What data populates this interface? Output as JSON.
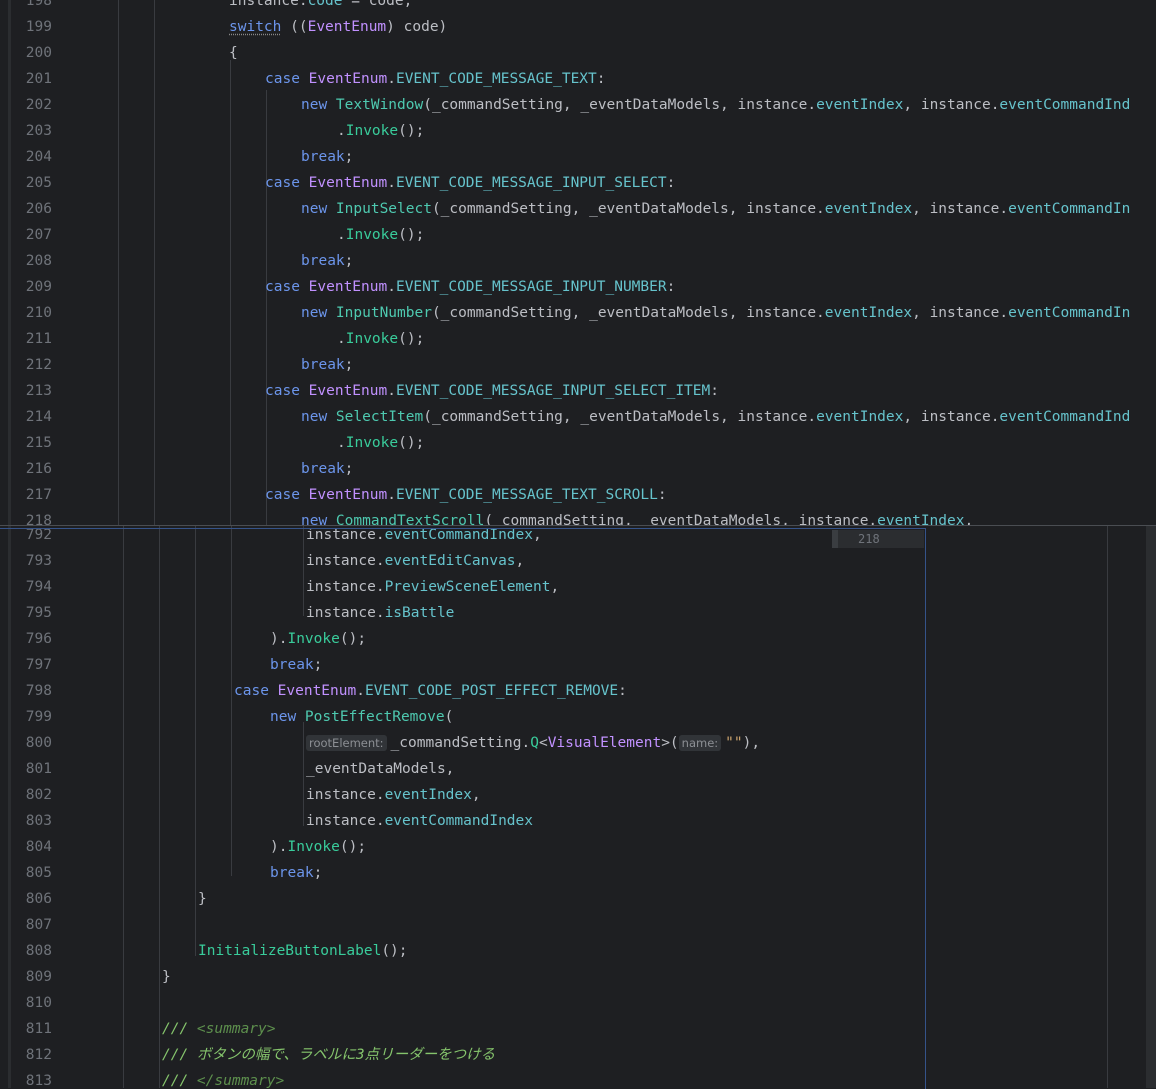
{
  "sticky_badge": "218",
  "top_lines": [
    {
      "n": "198",
      "indent": 7,
      "segs": [
        [
          "",
          "instance."
        ],
        [
          "pr",
          "code"
        ],
        [
          "",
          " = code;"
        ]
      ]
    },
    {
      "n": "199",
      "indent": 7,
      "segs": [
        [
          "kw squiggle",
          "switch"
        ],
        [
          "",
          " (("
        ],
        [
          "cl",
          "EventEnum"
        ],
        [
          "",
          ") code)"
        ]
      ]
    },
    {
      "n": "200",
      "indent": 7,
      "segs": [
        [
          "",
          "{"
        ]
      ]
    },
    {
      "n": "201",
      "indent": 8,
      "segs": [
        [
          "kw",
          "case "
        ],
        [
          "cl",
          "EventEnum"
        ],
        [
          "",
          "."
        ],
        [
          "pr",
          "EVENT_CODE_MESSAGE_TEXT"
        ],
        [
          "",
          ":"
        ]
      ]
    },
    {
      "n": "202",
      "indent": 9,
      "segs": [
        [
          "kw",
          "new "
        ],
        [
          "ty",
          "TextWindow"
        ],
        [
          "",
          "(_commandSetting, _eventDataModels, instance."
        ],
        [
          "pr",
          "eventIndex"
        ],
        [
          "",
          ", instance."
        ],
        [
          "pr",
          "eventCommandInd"
        ]
      ]
    },
    {
      "n": "203",
      "indent": 10,
      "segs": [
        [
          "",
          "."
        ],
        [
          "fn",
          "Invoke"
        ],
        [
          "",
          "();"
        ]
      ]
    },
    {
      "n": "204",
      "indent": 9,
      "segs": [
        [
          "kw",
          "break"
        ],
        [
          "",
          ";"
        ]
      ]
    },
    {
      "n": "205",
      "indent": 8,
      "segs": [
        [
          "kw",
          "case "
        ],
        [
          "cl",
          "EventEnum"
        ],
        [
          "",
          "."
        ],
        [
          "pr",
          "EVENT_CODE_MESSAGE_INPUT_SELECT"
        ],
        [
          "",
          ":"
        ]
      ]
    },
    {
      "n": "206",
      "indent": 9,
      "segs": [
        [
          "kw",
          "new "
        ],
        [
          "ty",
          "InputSelect"
        ],
        [
          "",
          "(_commandSetting, _eventDataModels, instance."
        ],
        [
          "pr",
          "eventIndex"
        ],
        [
          "",
          ", instance."
        ],
        [
          "pr",
          "eventCommandIn"
        ]
      ]
    },
    {
      "n": "207",
      "indent": 10,
      "segs": [
        [
          "",
          "."
        ],
        [
          "fn",
          "Invoke"
        ],
        [
          "",
          "();"
        ]
      ]
    },
    {
      "n": "208",
      "indent": 9,
      "segs": [
        [
          "kw",
          "break"
        ],
        [
          "",
          ";"
        ]
      ]
    },
    {
      "n": "209",
      "indent": 8,
      "segs": [
        [
          "kw",
          "case "
        ],
        [
          "cl",
          "EventEnum"
        ],
        [
          "",
          "."
        ],
        [
          "pr",
          "EVENT_CODE_MESSAGE_INPUT_NUMBER"
        ],
        [
          "",
          ":"
        ]
      ]
    },
    {
      "n": "210",
      "indent": 9,
      "segs": [
        [
          "kw",
          "new "
        ],
        [
          "ty",
          "InputNumber"
        ],
        [
          "",
          "(_commandSetting, _eventDataModels, instance."
        ],
        [
          "pr",
          "eventIndex"
        ],
        [
          "",
          ", instance."
        ],
        [
          "pr",
          "eventCommandIn"
        ]
      ]
    },
    {
      "n": "211",
      "indent": 10,
      "segs": [
        [
          "",
          "."
        ],
        [
          "fn",
          "Invoke"
        ],
        [
          "",
          "();"
        ]
      ]
    },
    {
      "n": "212",
      "indent": 9,
      "segs": [
        [
          "kw",
          "break"
        ],
        [
          "",
          ";"
        ]
      ]
    },
    {
      "n": "213",
      "indent": 8,
      "segs": [
        [
          "kw",
          "case "
        ],
        [
          "cl",
          "EventEnum"
        ],
        [
          "",
          "."
        ],
        [
          "pr",
          "EVENT_CODE_MESSAGE_INPUT_SELECT_ITEM"
        ],
        [
          "",
          ":"
        ]
      ]
    },
    {
      "n": "214",
      "indent": 9,
      "segs": [
        [
          "kw",
          "new "
        ],
        [
          "ty",
          "SelectItem"
        ],
        [
          "",
          "(_commandSetting, _eventDataModels, instance."
        ],
        [
          "pr",
          "eventIndex"
        ],
        [
          "",
          ", instance."
        ],
        [
          "pr",
          "eventCommandInd"
        ]
      ]
    },
    {
      "n": "215",
      "indent": 10,
      "segs": [
        [
          "",
          "."
        ],
        [
          "fn",
          "Invoke"
        ],
        [
          "",
          "();"
        ]
      ]
    },
    {
      "n": "216",
      "indent": 9,
      "segs": [
        [
          "kw",
          "break"
        ],
        [
          "",
          ";"
        ]
      ]
    },
    {
      "n": "217",
      "indent": 8,
      "segs": [
        [
          "kw",
          "case "
        ],
        [
          "cl",
          "EventEnum"
        ],
        [
          "",
          "."
        ],
        [
          "pr",
          "EVENT_CODE_MESSAGE_TEXT_SCROLL"
        ],
        [
          "",
          ":"
        ]
      ]
    },
    {
      "n": "218",
      "indent": 9,
      "segs": [
        [
          "kw",
          "new "
        ],
        [
          "ty",
          "CommandTextScroll"
        ],
        [
          "",
          "(_commandSetting, _eventDataModels, instance."
        ],
        [
          "pr",
          "eventIndex"
        ],
        [
          "",
          ","
        ]
      ]
    }
  ],
  "bottom_lines": [
    {
      "n": "792",
      "indent": 9,
      "segs": [
        [
          "",
          "instance."
        ],
        [
          "pr",
          "eventCommandIndex"
        ],
        [
          "",
          ","
        ]
      ]
    },
    {
      "n": "793",
      "indent": 9,
      "segs": [
        [
          "",
          "instance."
        ],
        [
          "pr",
          "eventEditCanvas"
        ],
        [
          "",
          ","
        ]
      ]
    },
    {
      "n": "794",
      "indent": 9,
      "segs": [
        [
          "",
          "instance."
        ],
        [
          "pr",
          "PreviewSceneElement"
        ],
        [
          "",
          ","
        ]
      ]
    },
    {
      "n": "795",
      "indent": 9,
      "segs": [
        [
          "",
          "instance."
        ],
        [
          "pr",
          "isBattle"
        ]
      ]
    },
    {
      "n": "796",
      "indent": 8,
      "segs": [
        [
          "",
          ")."
        ],
        [
          "fn",
          "Invoke"
        ],
        [
          "",
          "();"
        ]
      ]
    },
    {
      "n": "797",
      "indent": 8,
      "segs": [
        [
          "kw",
          "break"
        ],
        [
          "",
          ";"
        ]
      ]
    },
    {
      "n": "798",
      "indent": 7,
      "segs": [
        [
          "kw",
          "case "
        ],
        [
          "cl",
          "EventEnum"
        ],
        [
          "",
          "."
        ],
        [
          "pr",
          "EVENT_CODE_POST_EFFECT_REMOVE"
        ],
        [
          "",
          ":"
        ]
      ]
    },
    {
      "n": "799",
      "indent": 8,
      "segs": [
        [
          "kw",
          "new "
        ],
        [
          "ty",
          "PostEffectRemove"
        ],
        [
          "",
          "("
        ]
      ]
    },
    {
      "n": "800",
      "indent": 9,
      "segs": [
        [
          "hint",
          "rootElement:"
        ],
        [
          "",
          "_commandSetting."
        ],
        [
          "fn",
          "Q"
        ],
        [
          "",
          "<"
        ],
        [
          "cl",
          "VisualElement"
        ],
        [
          "",
          ">("
        ],
        [
          "hint",
          "name:"
        ],
        [
          "st",
          "\"\""
        ],
        [
          "",
          "),"
        ]
      ]
    },
    {
      "n": "801",
      "indent": 9,
      "segs": [
        [
          "",
          "_eventDataModels,"
        ]
      ]
    },
    {
      "n": "802",
      "indent": 9,
      "segs": [
        [
          "",
          "instance."
        ],
        [
          "pr",
          "eventIndex"
        ],
        [
          "",
          ","
        ]
      ]
    },
    {
      "n": "803",
      "indent": 9,
      "segs": [
        [
          "",
          "instance."
        ],
        [
          "pr",
          "eventCommandIndex"
        ]
      ]
    },
    {
      "n": "804",
      "indent": 8,
      "segs": [
        [
          "",
          ")."
        ],
        [
          "fn",
          "Invoke"
        ],
        [
          "",
          "();"
        ]
      ]
    },
    {
      "n": "805",
      "indent": 8,
      "segs": [
        [
          "kw",
          "break"
        ],
        [
          "",
          ";"
        ]
      ]
    },
    {
      "n": "806",
      "indent": 6,
      "segs": [
        [
          "",
          "}"
        ]
      ]
    },
    {
      "n": "807",
      "indent": 0,
      "segs": []
    },
    {
      "n": "808",
      "indent": 6,
      "segs": [
        [
          "fn",
          "InitializeButtonLabel"
        ],
        [
          "",
          "();"
        ]
      ]
    },
    {
      "n": "809",
      "indent": 5,
      "segs": [
        [
          "",
          "}"
        ]
      ]
    },
    {
      "n": "810",
      "indent": 0,
      "segs": []
    },
    {
      "n": "811",
      "indent": 5,
      "segs": [
        [
          "cm",
          "/// "
        ],
        [
          "xd",
          "<"
        ],
        [
          "xd",
          "summary"
        ],
        [
          "xd",
          ">"
        ]
      ]
    },
    {
      "n": "812",
      "indent": 5,
      "segs": [
        [
          "cm",
          "/// ボタンの幅で、ラベルに3点リーダーをつける"
        ]
      ]
    },
    {
      "n": "813",
      "indent": 5,
      "segs": [
        [
          "cm",
          "/// "
        ],
        [
          "xd",
          "</"
        ],
        [
          "xd",
          "summary"
        ],
        [
          "xd",
          ">"
        ]
      ]
    }
  ]
}
